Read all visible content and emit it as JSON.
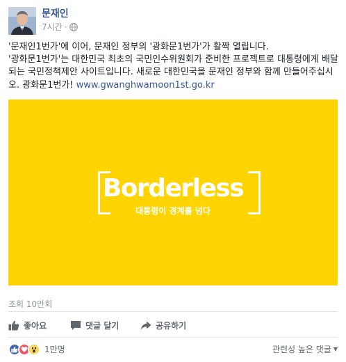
{
  "post": {
    "author": "문재인",
    "time": "7시간",
    "time_separator": "·",
    "text_line1": "'문재인1번가'에 이어, 문재인 정부의 '광화문1번가'가 활짝 열립니다.",
    "text_body": "'광화문1번가'는 대한민국 최초의 국민인수위원회가 준비한 프로젝트로 대통령에게 배달되는 국민정책제안 사이트입니다. 새로운 대한민국을 문재인 정부와 함께 만들어주십시오. 광화문1번가! ",
    "link": "www.gwanghwamoon1st.go.kr"
  },
  "media": {
    "brand": "Borderless",
    "subtitle": "대통령이 경계를 넘다",
    "background_color": "#ffd400"
  },
  "stats": {
    "views": "조회 10만회",
    "reaction_count": "1만명"
  },
  "actions": {
    "like": "좋아요",
    "comment": "댓글 달기",
    "share": "공유하기"
  },
  "comments": {
    "sort_label": "관련성 높은 댓글"
  },
  "icons": {
    "globe": "globe-icon",
    "like": "thumbs-up-icon",
    "comment": "comment-icon",
    "share": "share-arrow-icon",
    "reactions": [
      "like-reaction-icon",
      "love-reaction-icon",
      "wow-reaction-icon"
    ]
  },
  "colors": {
    "link": "#365899",
    "accent": "#4267b2"
  }
}
